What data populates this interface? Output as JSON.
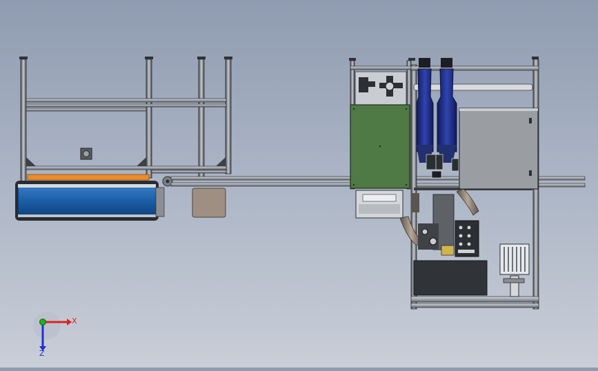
{
  "viewport": {
    "background_top": "#8f9bb0",
    "background_bottom": "#c9ced7"
  },
  "colors": {
    "frame": "#3c3f44",
    "frame_light": "#8a8d92",
    "conveyor_blue": "#1a5fa8",
    "belt_orange": "#ee8a2a",
    "panel_green": "#4f7a45",
    "cabinet_gray": "#9a9da2",
    "vessel_navy": "#1f2e86",
    "axis_x": "#e02020",
    "axis_y": "#20b020",
    "axis_z": "#2030d0"
  },
  "triad": {
    "x_label": "X",
    "z_label": "Z",
    "icon": "coordinate-triad-icon"
  }
}
